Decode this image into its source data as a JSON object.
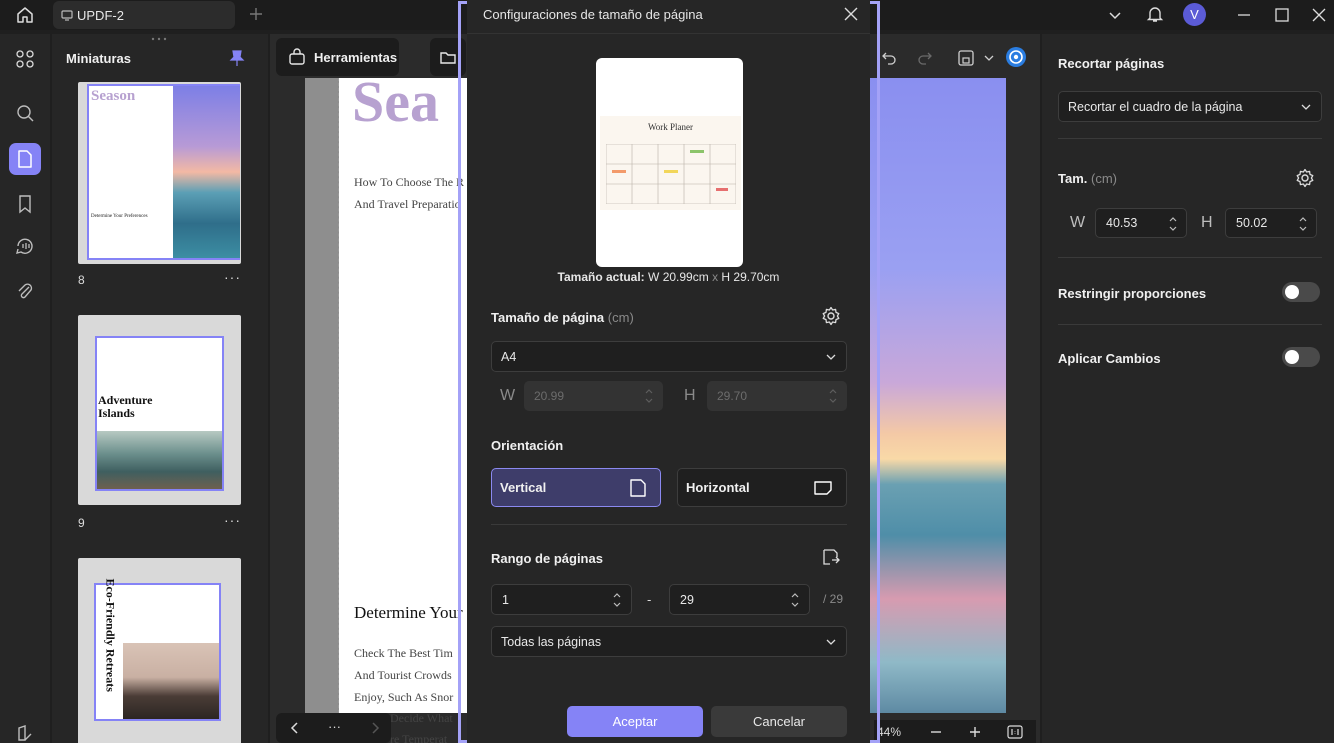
{
  "titlebar": {
    "tab_title": "UPDF-2",
    "avatar_letter": "V"
  },
  "thumbnails": {
    "title": "Miniaturas",
    "pages": [
      {
        "number": "8",
        "heading": "Season",
        "subheading": "Determine Your Preferences"
      },
      {
        "number": "9",
        "heading_line1": "Adventure",
        "heading_line2": "Islands"
      },
      {
        "number": "",
        "heading": "Eco-Friendly Retreats"
      }
    ],
    "more": "···"
  },
  "toolbar": {
    "tools_label": "Herramientas"
  },
  "document": {
    "big_title": "Sea",
    "intro_line1": "How To Choose The R",
    "intro_line2": "And Travel Preparatio",
    "section_heading": "Determine Your",
    "body_lines": [
      "Check The Best Tim",
      "And Tourist Crowds",
      "Enjoy, Such As Snor",
      "Decide What",
      "re Temperat"
    ],
    "zoom": "44%",
    "nav_more": "···"
  },
  "right_panel": {
    "title": "Recortar páginas",
    "crop_mode": "Recortar el cuadro de la página",
    "size_label": "Tam.",
    "size_unit": "(cm)",
    "w_label": "W",
    "w_value": "40.53",
    "h_label": "H",
    "h_value": "50.02",
    "keep_ratio_label": "Restringir proporciones",
    "apply_label": "Aplicar Cambios"
  },
  "dialog": {
    "title": "Configuraciones de tamaño de página",
    "preview_title": "Work Planer",
    "current_size_label": "Tamaño actual:",
    "current_w": "W 20.99cm",
    "times": "x",
    "current_h": "H 29.70cm",
    "page_size_label": "Tamaño de página",
    "page_size_unit": "(cm)",
    "page_size_value": "A4",
    "w_label": "W",
    "w_value": "20.99",
    "h_label": "H",
    "h_value": "29.70",
    "orientation_label": "Orientación",
    "orientation_vertical": "Vertical",
    "orientation_horizontal": "Horizontal",
    "range_label": "Rango de páginas",
    "range_from": "1",
    "range_dash": "-",
    "range_to": "29",
    "range_total": "/ 29",
    "range_scope": "Todas las páginas",
    "accept": "Aceptar",
    "cancel": "Cancelar"
  },
  "colors": {
    "accent": "#8583f6",
    "selection_frame": "#a4a2f7",
    "panel": "#262626",
    "background": "#1f1f1f"
  }
}
